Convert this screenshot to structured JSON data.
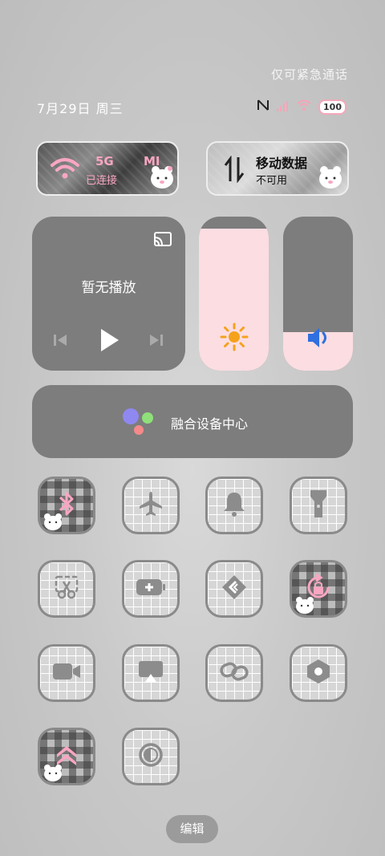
{
  "status": {
    "emergency_text": "仅可紧急通话",
    "date": "7月29日 周三",
    "battery": "100"
  },
  "network": {
    "wifi_label": "5G",
    "wifi_extra": "MI",
    "wifi_sub": "已连接",
    "mobile_label": "移动数据",
    "mobile_sub": "不可用"
  },
  "media": {
    "title": "暂无播放"
  },
  "sliders": {
    "brightness_level": 0.92,
    "volume_level": 0.25
  },
  "fusion": {
    "label": "融合设备中心"
  },
  "footer": {
    "edit_label": "编辑"
  },
  "colors": {
    "accent_pink": "#f8a6c2",
    "slider_fill": "#fbdde2",
    "sun": "#f5a21b",
    "speaker": "#2f6fe0"
  },
  "tiles": [
    {
      "name": "bluetooth",
      "active": true
    },
    {
      "name": "airplane",
      "active": false
    },
    {
      "name": "bell",
      "active": false
    },
    {
      "name": "flashlight",
      "active": false
    },
    {
      "name": "screenshot",
      "active": false
    },
    {
      "name": "battery-saver",
      "active": false
    },
    {
      "name": "share",
      "active": false
    },
    {
      "name": "rotation-lock",
      "active": true
    },
    {
      "name": "screen-record",
      "active": false
    },
    {
      "name": "cast",
      "active": false
    },
    {
      "name": "link",
      "active": false
    },
    {
      "name": "settings",
      "active": false
    },
    {
      "name": "performance",
      "active": true
    },
    {
      "name": "dark-mode",
      "active": false
    }
  ]
}
